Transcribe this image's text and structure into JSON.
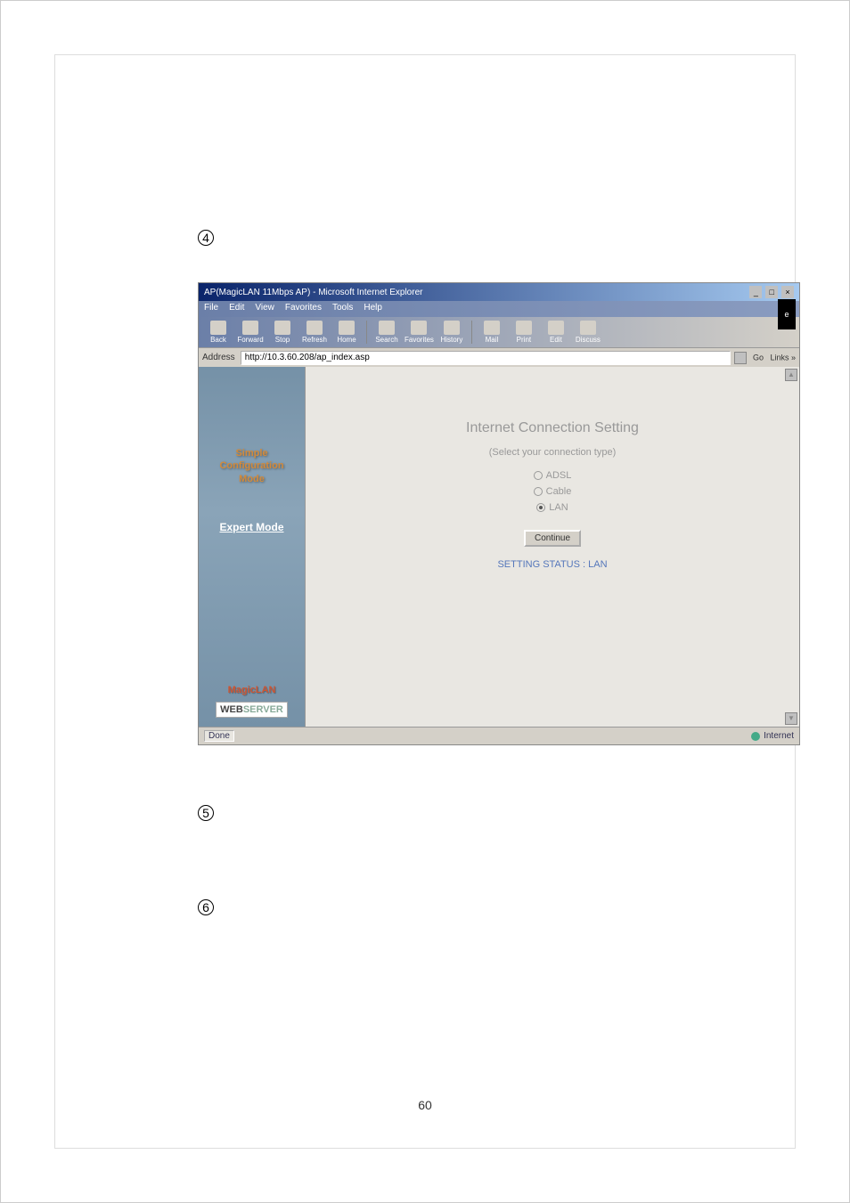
{
  "labels": {
    "four": "4",
    "five": "5",
    "six": "6"
  },
  "ie": {
    "title": "AP(MagicLAN 11Mbps AP) - Microsoft Internet Explorer",
    "menubar": [
      "File",
      "Edit",
      "View",
      "Favorites",
      "Tools",
      "Help"
    ],
    "toolbar": {
      "back": "Back",
      "forward": "Forward",
      "stop": "Stop",
      "refresh": "Refresh",
      "home": "Home",
      "search": "Search",
      "favorites": "Favorites",
      "history": "History",
      "mail": "Mail",
      "print": "Print",
      "edit": "Edit",
      "discuss": "Discuss"
    },
    "address_label": "Address",
    "address_value": "http://10.3.60.208/ap_index.asp",
    "go_label": "Go",
    "links_label": "Links »",
    "status_done": "Done",
    "status_zone": "Internet"
  },
  "sidebar": {
    "simple_line1": "Simple",
    "simple_line2": "Configuration",
    "simple_line3": "Mode",
    "expert": "Expert Mode",
    "magiclan": "MagicLAN",
    "logo_web": "WEB",
    "logo_server": "SERVER"
  },
  "main": {
    "title": "Internet Connection Setting",
    "subtitle": "(Select your connection type)",
    "options": {
      "adsl": "ADSL",
      "cable": "Cable",
      "lan": "LAN"
    },
    "selected": "lan",
    "continue": "Continue",
    "status": "SETTING STATUS : LAN"
  },
  "page_number": "60"
}
